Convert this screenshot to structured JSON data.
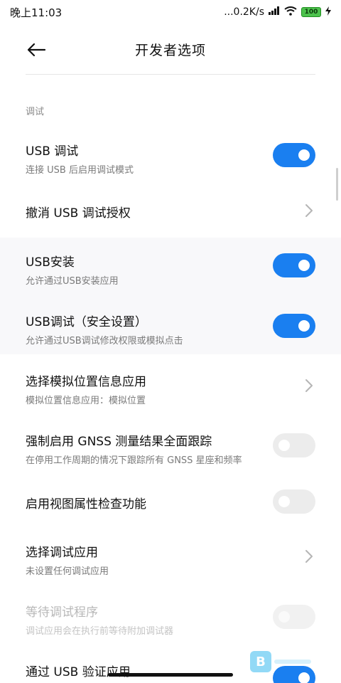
{
  "status_bar": {
    "time": "晚上11:03",
    "network_speed": "...0.2K/s",
    "battery": "100"
  },
  "header": {
    "title": "开发者选项"
  },
  "section": {
    "label": "调试"
  },
  "rows": [
    {
      "title": "USB 调试",
      "subtitle": "连接 USB 后启用调试模式",
      "control": "toggle",
      "state": "on"
    },
    {
      "title": "撤消 USB 调试授权",
      "subtitle": "",
      "control": "chevron"
    },
    {
      "title": "USB安装",
      "subtitle": "允许通过USB安装应用",
      "control": "toggle",
      "state": "on"
    },
    {
      "title": "USB调试（安全设置）",
      "subtitle": "允许通过USB调试修改权限或模拟点击",
      "control": "toggle",
      "state": "on"
    },
    {
      "title": "选择模拟位置信息应用",
      "subtitle": "模拟位置信息应用：模拟位置",
      "control": "chevron"
    },
    {
      "title": "强制启用 GNSS 测量结果全面跟踪",
      "subtitle": "在停用工作周期的情况下跟踪所有 GNSS 星座和频率",
      "control": "toggle",
      "state": "off"
    },
    {
      "title": "启用视图属性检查功能",
      "subtitle": "",
      "control": "toggle",
      "state": "off"
    },
    {
      "title": "选择调试应用",
      "subtitle": "未设置任何调试应用",
      "control": "chevron"
    },
    {
      "title": "等待调试程序",
      "subtitle": "调试应用会在执行前等待附加调试器",
      "control": "toggle",
      "state": "disabled"
    },
    {
      "title": "通过 USB 验证应用",
      "subtitle": "",
      "control": "toggle",
      "state": "on"
    }
  ],
  "colors": {
    "toggle_on": "#1a7ff0",
    "toggle_off": "#ececec",
    "battery": "#4cc24c"
  }
}
